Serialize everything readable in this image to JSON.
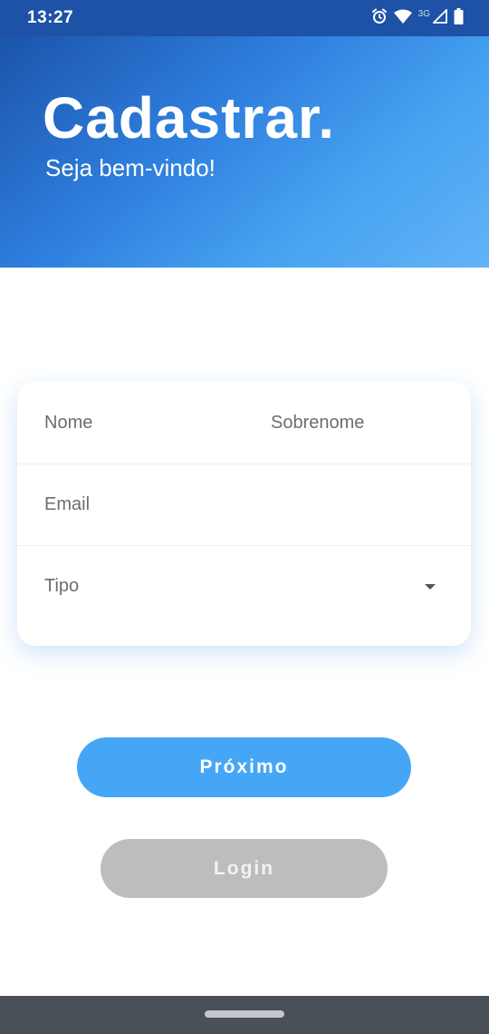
{
  "status_bar": {
    "time": "13:27",
    "network_label": "3G",
    "icons": [
      "alarm-icon",
      "wifi-icon",
      "signal-icon",
      "battery-icon"
    ]
  },
  "header": {
    "title": "Cadastrar.",
    "subtitle": "Seja bem-vindo!"
  },
  "form": {
    "first_name": {
      "placeholder": "Nome",
      "value": ""
    },
    "last_name": {
      "placeholder": "Sobrenome",
      "value": ""
    },
    "email": {
      "placeholder": "Email",
      "value": ""
    },
    "type": {
      "selected": "Tipo",
      "icon": "dropdown-arrow-icon"
    }
  },
  "buttons": {
    "next_label": "Próximo",
    "login_label": "Login"
  },
  "colors": {
    "header_gradient_start": "#1b54ab",
    "header_gradient_end": "#62b3f6",
    "primary_button": "#45a6f5",
    "secondary_button": "#bdbdbd",
    "nav_bar": "#4a5058"
  }
}
